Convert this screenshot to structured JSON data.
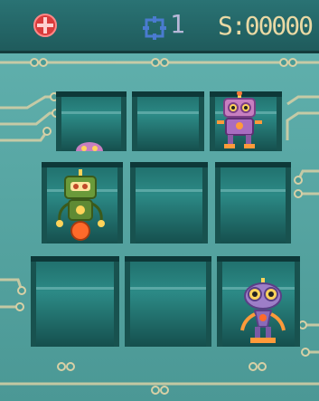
{
  "hud": {
    "target_icon": "red-target-icon",
    "crosshair_icon": "crosshair-icon",
    "crosshair_count": "1",
    "score": "S:00000"
  },
  "board": {
    "rows": 3,
    "cols": 3,
    "cells": [
      {
        "row": 1,
        "col": 1,
        "content": "robot-peeking"
      },
      {
        "row": 1,
        "col": 2,
        "content": "empty"
      },
      {
        "row": 1,
        "col": 3,
        "content": "pink-robot"
      },
      {
        "row": 2,
        "col": 1,
        "content": "green-robot"
      },
      {
        "row": 2,
        "col": 2,
        "content": "empty"
      },
      {
        "row": 2,
        "col": 3,
        "content": "empty"
      },
      {
        "row": 3,
        "col": 1,
        "content": "empty"
      },
      {
        "row": 3,
        "col": 2,
        "content": "empty"
      },
      {
        "row": 3,
        "col": 3,
        "content": "purple-robot"
      }
    ]
  },
  "colors": {
    "board": "#5fafac",
    "pit": "#1f6d6a",
    "hud": "#2a7374",
    "score_text": "#e9d9a4"
  }
}
